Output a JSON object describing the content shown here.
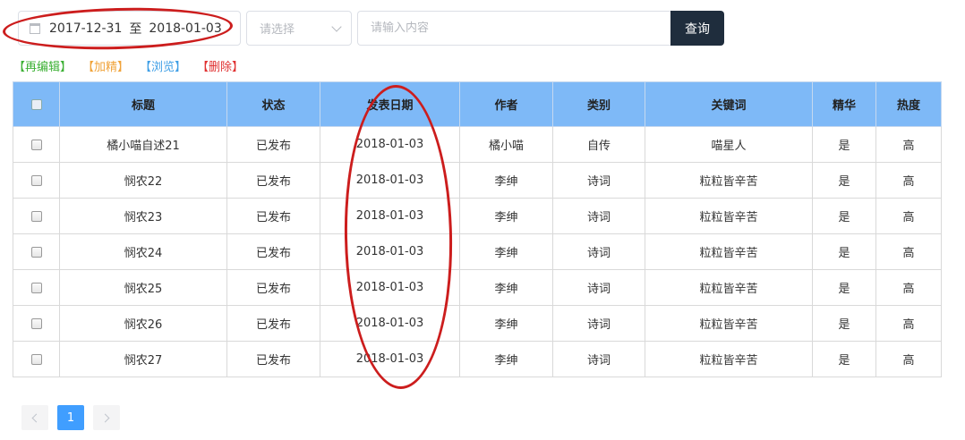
{
  "filter": {
    "date_start": "2017-12-31",
    "date_sep": "至",
    "date_end": "2018-01-03",
    "status_placeholder": "请选择",
    "search_placeholder": "请输入内容",
    "query_label": "查询"
  },
  "actions": {
    "edit": "【再编辑】",
    "featured": "【加精】",
    "browse": "【浏览】",
    "delete": "【删除】"
  },
  "columns": [
    "标题",
    "状态",
    "发表日期",
    "作者",
    "类别",
    "关键词",
    "精华",
    "热度"
  ],
  "rows": [
    [
      "橘小喵自述21",
      "已发布",
      "2018-01-03",
      "橘小喵",
      "自传",
      "喵星人",
      "是",
      "高"
    ],
    [
      "悯农22",
      "已发布",
      "2018-01-03",
      "李绅",
      "诗词",
      "粒粒皆辛苦",
      "是",
      "高"
    ],
    [
      "悯农23",
      "已发布",
      "2018-01-03",
      "李绅",
      "诗词",
      "粒粒皆辛苦",
      "是",
      "高"
    ],
    [
      "悯农24",
      "已发布",
      "2018-01-03",
      "李绅",
      "诗词",
      "粒粒皆辛苦",
      "是",
      "高"
    ],
    [
      "悯农25",
      "已发布",
      "2018-01-03",
      "李绅",
      "诗词",
      "粒粒皆辛苦",
      "是",
      "高"
    ],
    [
      "悯农26",
      "已发布",
      "2018-01-03",
      "李绅",
      "诗词",
      "粒粒皆辛苦",
      "是",
      "高"
    ],
    [
      "悯农27",
      "已发布",
      "2018-01-03",
      "李绅",
      "诗词",
      "粒粒皆辛苦",
      "是",
      "高"
    ]
  ],
  "pagination": {
    "current_page": "1"
  },
  "colors": {
    "header_bg": "#7eb9f7",
    "query_button_bg": "#1f2d3d",
    "page_active": "#409eff",
    "annotation": "#cc1d1d"
  },
  "icons": {
    "date": "calendar-icon",
    "select": "chevron-down-icon",
    "prev": "chevron-left-icon",
    "next": "chevron-right-icon"
  }
}
